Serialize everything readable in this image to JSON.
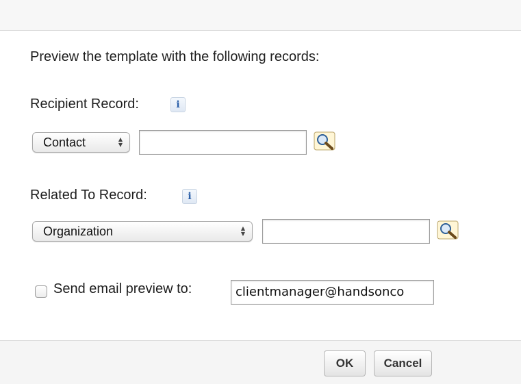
{
  "dialog": {
    "intro": "Preview the template with the following records:",
    "recipient": {
      "label": "Recipient Record:",
      "info": "i",
      "select_value": "Contact",
      "input_value": ""
    },
    "related": {
      "label": "Related To Record:",
      "info": "i",
      "select_value": "Organization",
      "input_value": ""
    },
    "email_preview": {
      "label": "Send email preview to:",
      "checked": false,
      "input_value": "clientmanager@handsonco"
    },
    "buttons": {
      "ok_label": "OK",
      "cancel_label": "Cancel"
    }
  },
  "icons": {
    "info": "info-icon",
    "lookup": "magnifier-lookup-icon",
    "select_arrows": "up-down-arrows-icon"
  },
  "colors": {
    "info_blue": "#2b5fa8",
    "band_gray": "#f5f5f5"
  }
}
